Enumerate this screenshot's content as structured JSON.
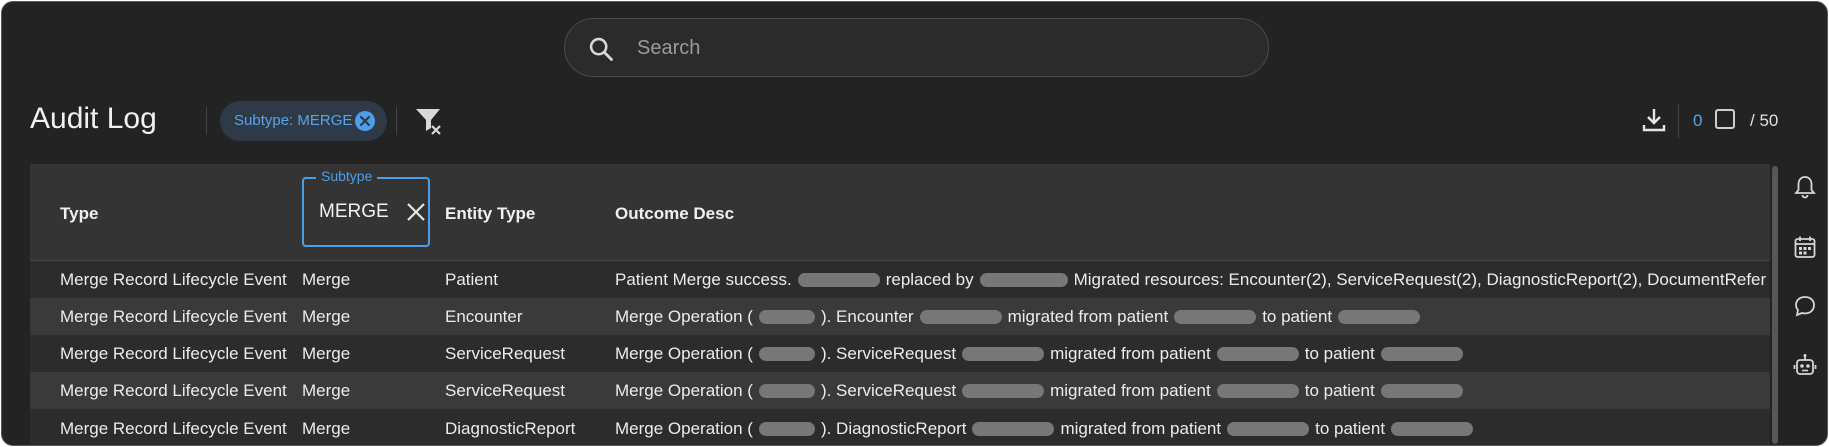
{
  "search": {
    "placeholder": "Search",
    "icon": "search-icon"
  },
  "header": {
    "title": "Audit Log",
    "chip_label": "Subtype: MERGE",
    "selected_count": "0",
    "total": "/ 50"
  },
  "table": {
    "columns": {
      "type": "Type",
      "subtype": "Subtype",
      "entity_type": "Entity Type",
      "outcome_desc": "Outcome Desc"
    },
    "subtype_filter": {
      "value": "MERGE"
    },
    "rows": [
      {
        "type": "Merge Record Lifecycle Event",
        "subtype": "Merge",
        "entity_type": "Patient",
        "desc": [
          "Patient Merge success.",
          "replaced by",
          "Migrated resources: Encounter(2), ServiceRequest(2), DiagnosticReport(2), DocumentRefer"
        ]
      },
      {
        "type": "Merge Record Lifecycle Event",
        "subtype": "Merge",
        "entity_type": "Encounter",
        "desc": [
          "Merge Operation (",
          "). Encounter",
          "migrated from patient",
          "to patient"
        ]
      },
      {
        "type": "Merge Record Lifecycle Event",
        "subtype": "Merge",
        "entity_type": "ServiceRequest",
        "desc": [
          "Merge Operation (",
          "). ServiceRequest",
          "migrated from patient",
          "to patient"
        ]
      },
      {
        "type": "Merge Record Lifecycle Event",
        "subtype": "Merge",
        "entity_type": "ServiceRequest",
        "desc": [
          "Merge Operation (",
          "). ServiceRequest",
          "migrated from patient",
          "to patient"
        ]
      },
      {
        "type": "Merge Record Lifecycle Event",
        "subtype": "Merge",
        "entity_type": "DiagnosticReport",
        "desc": [
          "Merge Operation (",
          "). DiagnosticReport",
          "migrated from patient",
          "to patient"
        ]
      }
    ]
  },
  "sidebar_icons": [
    "bell-icon",
    "calendar-icon",
    "chat-icon",
    "robot-icon"
  ],
  "colors": {
    "accent": "#4a9fe8",
    "background": "#232323",
    "chip_background": "#2f3a47"
  }
}
